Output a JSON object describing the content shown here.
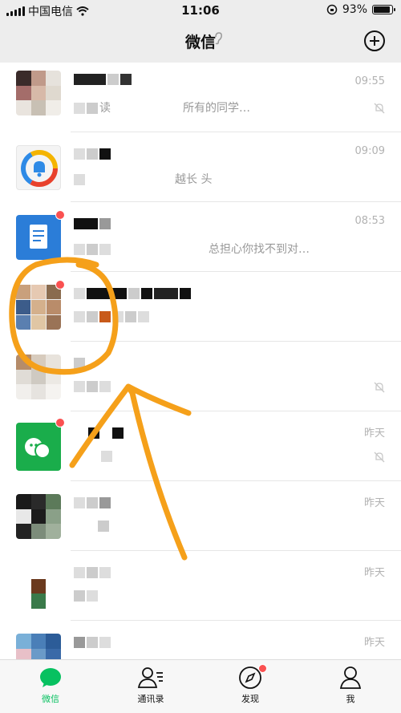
{
  "status_bar": {
    "carrier": "中国电信",
    "time": "11:06",
    "battery": "93%",
    "battery_level": 0.93
  },
  "header": {
    "title": "微信"
  },
  "chats": [
    {
      "name": "",
      "preview": "所有的同学…",
      "preview_fragment": "读",
      "time": "09:55",
      "muted": true,
      "unread_dot": false
    },
    {
      "name": "",
      "preview": "越长 头",
      "time": "09:09",
      "muted": false,
      "unread_dot": false
    },
    {
      "name": "",
      "preview": "总担心你找不到对…",
      "time": "08:53",
      "muted": false,
      "unread_dot": true
    },
    {
      "name": "",
      "preview": "",
      "time": "",
      "muted": false,
      "unread_dot": true
    },
    {
      "name": "",
      "preview": "",
      "time": "",
      "muted": true,
      "unread_dot": false
    },
    {
      "name": "",
      "preview": "",
      "time": "昨天",
      "muted": true,
      "unread_dot": true
    },
    {
      "name": "",
      "preview": "",
      "time": "昨天",
      "muted": false,
      "unread_dot": false
    },
    {
      "name": "",
      "preview": "",
      "time": "昨天",
      "muted": false,
      "unread_dot": false
    },
    {
      "name": "",
      "preview": "",
      "time": "昨天",
      "muted": false,
      "unread_dot": false
    }
  ],
  "tabs": [
    {
      "label": "微信",
      "icon": "chat-bubble-icon",
      "active": true,
      "badge": false
    },
    {
      "label": "通讯录",
      "icon": "contacts-icon",
      "active": false,
      "badge": false
    },
    {
      "label": "发现",
      "icon": "compass-icon",
      "active": false,
      "badge": true
    },
    {
      "label": "我",
      "icon": "person-icon",
      "active": false,
      "badge": false
    }
  ],
  "colors": {
    "accent": "#07c160",
    "badge": "#fa5151",
    "annotation": "#f5a01a"
  }
}
